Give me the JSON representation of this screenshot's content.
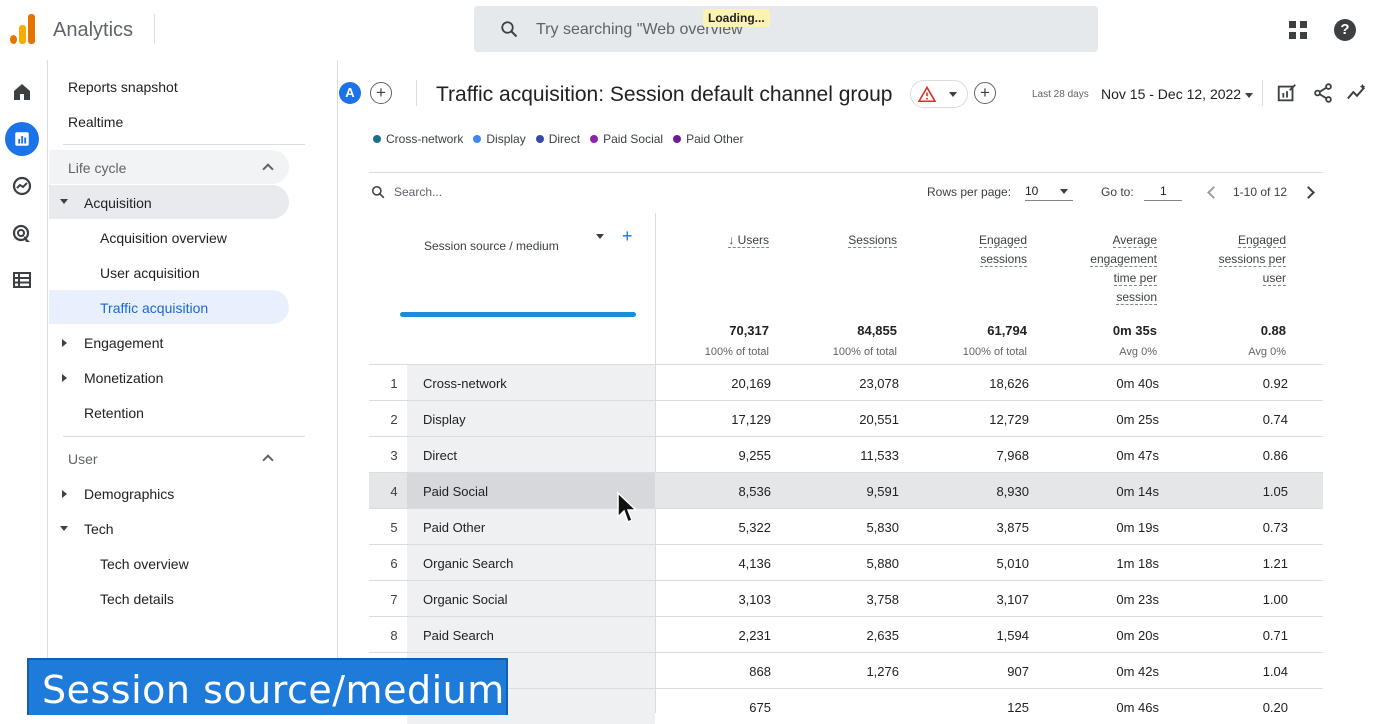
{
  "app": {
    "title": "Analytics",
    "loading": "Loading..."
  },
  "search": {
    "placeholder": "Try searching \"Web overview\""
  },
  "nav": {
    "reports_snapshot": "Reports snapshot",
    "realtime": "Realtime",
    "lifecycle": "Life cycle",
    "acquisition": "Acquisition",
    "acquisition_overview": "Acquisition overview",
    "user_acquisition": "User acquisition",
    "traffic_acquisition": "Traffic acquisition",
    "engagement": "Engagement",
    "monetization": "Monetization",
    "retention": "Retention",
    "user": "User",
    "demographics": "Demographics",
    "tech": "Tech",
    "tech_overview": "Tech overview",
    "tech_details": "Tech details"
  },
  "header": {
    "avatar_letter": "A",
    "title": "Traffic acquisition: Session default channel group",
    "date_label": "Last 28 days",
    "date_range": "Nov 15 - Dec 12, 2022"
  },
  "legend": [
    {
      "label": "Cross-network",
      "color": "#1a6e8e"
    },
    {
      "label": "Display",
      "color": "#4285f4"
    },
    {
      "label": "Direct",
      "color": "#3949ab"
    },
    {
      "label": "Paid Social",
      "color": "#8e24aa"
    },
    {
      "label": "Paid Other",
      "color": "#6a1b9a"
    }
  ],
  "toolbar": {
    "search_placeholder": "Search...",
    "rows_per_page_label": "Rows per page:",
    "rows_per_page": "10",
    "goto_label": "Go to:",
    "goto_value": "1",
    "pager": "1-10 of 12"
  },
  "table": {
    "dimension_header": "Session source / medium",
    "columns": [
      {
        "lines": [
          "↓ Users"
        ]
      },
      {
        "lines": [
          "Sessions"
        ]
      },
      {
        "lines": [
          "Engaged",
          "sessions"
        ]
      },
      {
        "lines": [
          "Average",
          "engagement",
          "time per",
          "session"
        ]
      },
      {
        "lines": [
          "Engaged",
          "sessions per",
          "user"
        ]
      }
    ],
    "totals": [
      "70,317",
      "84,855",
      "61,794",
      "0m 35s",
      "0.88"
    ],
    "totals_sub": [
      "100% of total",
      "100% of total",
      "100% of total",
      "Avg 0%",
      "Avg 0%"
    ],
    "rows": [
      {
        "idx": "1",
        "dim": "Cross-network",
        "vals": [
          "20,169",
          "23,078",
          "18,626",
          "0m 40s",
          "0.92"
        ]
      },
      {
        "idx": "2",
        "dim": "Display",
        "vals": [
          "17,129",
          "20,551",
          "12,729",
          "0m 25s",
          "0.74"
        ]
      },
      {
        "idx": "3",
        "dim": "Direct",
        "vals": [
          "9,255",
          "11,533",
          "7,968",
          "0m 47s",
          "0.86"
        ]
      },
      {
        "idx": "4",
        "dim": "Paid Social",
        "vals": [
          "8,536",
          "9,591",
          "8,930",
          "0m 14s",
          "1.05"
        ]
      },
      {
        "idx": "5",
        "dim": "Paid Other",
        "vals": [
          "5,322",
          "5,830",
          "3,875",
          "0m 19s",
          "0.73"
        ]
      },
      {
        "idx": "6",
        "dim": "Organic Search",
        "vals": [
          "4,136",
          "5,880",
          "5,010",
          "1m 18s",
          "1.21"
        ]
      },
      {
        "idx": "7",
        "dim": "Organic Social",
        "vals": [
          "3,103",
          "3,758",
          "3,107",
          "0m 23s",
          "1.00"
        ]
      },
      {
        "idx": "8",
        "dim": "Paid Search",
        "vals": [
          "2,231",
          "2,635",
          "1,594",
          "0m 20s",
          "0.71"
        ]
      },
      {
        "idx": "",
        "dim": "",
        "vals": [
          "868",
          "1,276",
          "907",
          "0m 42s",
          "1.04"
        ]
      },
      {
        "idx": "",
        "dim": "",
        "vals": [
          "675",
          "",
          "125",
          "0m 46s",
          "0.20"
        ]
      }
    ]
  },
  "banner": {
    "text": "Session source/medium"
  }
}
